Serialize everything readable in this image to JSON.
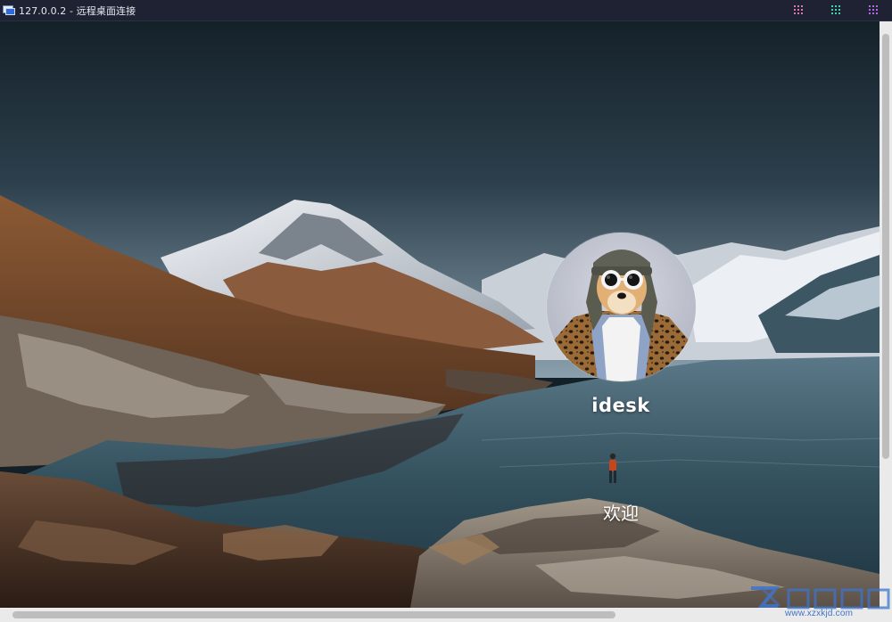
{
  "window": {
    "title": "127.0.0.2 - 远程桌面连接",
    "icon": "remote-desktop-icon",
    "controls": [
      {
        "name": "minimize-button",
        "icon": "dots-grid-pink"
      },
      {
        "name": "maximize-button",
        "icon": "dots-grid-green"
      },
      {
        "name": "close-button",
        "icon": "dots-grid-purple"
      }
    ]
  },
  "lockscreen": {
    "username": "idesk",
    "status": "欢迎",
    "avatar": "dog-with-sunglasses-avatar"
  },
  "watermark": {
    "text": "",
    "url": "www.xzxkjd.com"
  },
  "colors": {
    "titlebar": "#1f2233",
    "sky_top": "#182530",
    "lake": "#3a5a68",
    "mountain_snow": "#e6e8ee",
    "hillside": "#7a4a2c",
    "scrollbar": "#eaeaea",
    "watermark": "#3f73c9"
  }
}
